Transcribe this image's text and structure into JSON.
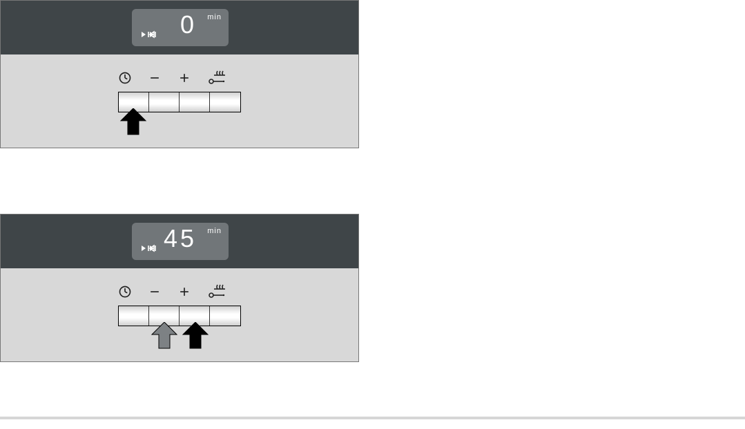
{
  "panels": [
    {
      "lcd": {
        "value": "0",
        "unit": "min",
        "mode_icon": "play-end"
      },
      "buttons": [
        {
          "icon": "clock"
        },
        {
          "icon": "minus"
        },
        {
          "icon": "plus"
        },
        {
          "icon": "heat-key"
        }
      ],
      "arrows": [
        {
          "target": 0,
          "color": "#000000"
        }
      ]
    },
    {
      "lcd": {
        "value": "45",
        "unit": "min",
        "mode_icon": "play-end"
      },
      "buttons": [
        {
          "icon": "clock"
        },
        {
          "icon": "minus"
        },
        {
          "icon": "plus"
        },
        {
          "icon": "heat-key"
        }
      ],
      "arrows": [
        {
          "target": 1,
          "color": "#7d8184"
        },
        {
          "target": 2,
          "color": "#000000"
        }
      ]
    }
  ]
}
